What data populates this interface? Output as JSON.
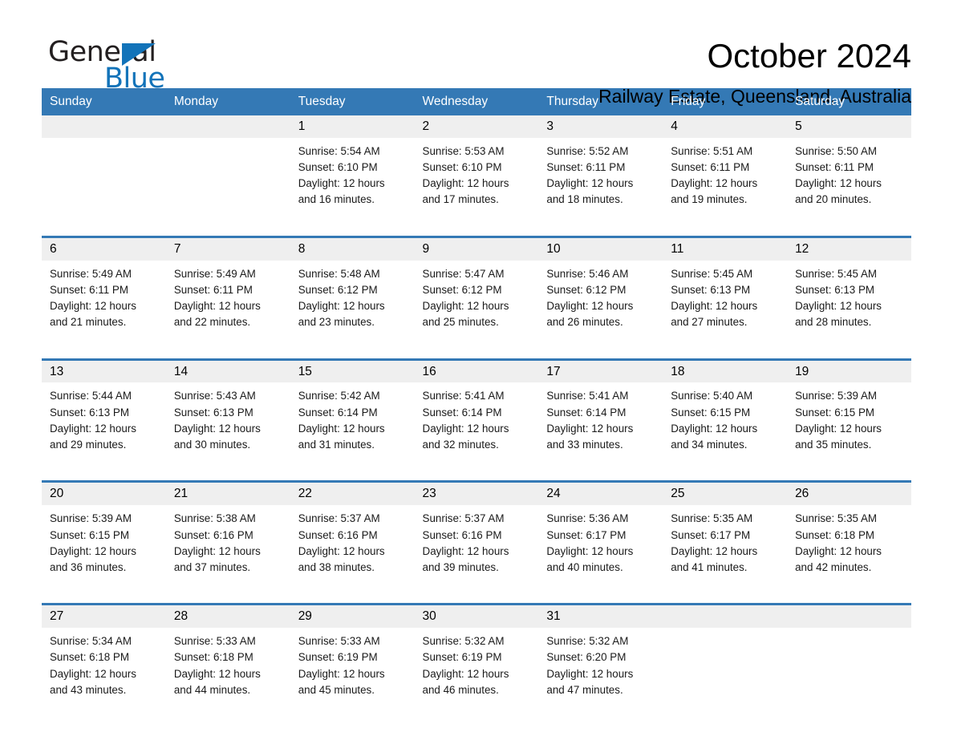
{
  "logo": {
    "word_one": "General",
    "word_two": "Blue",
    "triangle_color": "#1273b9"
  },
  "header": {
    "title": "October 2024",
    "location": "Railway Estate, Queensland, Australia"
  },
  "theme": {
    "header_blue": "#3479b5",
    "daynum_band": "#efefef",
    "text": "#000000"
  },
  "calendar": {
    "weekday_headers": [
      "Sunday",
      "Monday",
      "Tuesday",
      "Wednesday",
      "Thursday",
      "Friday",
      "Saturday"
    ],
    "weeks": [
      [
        {
          "day": "",
          "sunrise": "",
          "sunset": "",
          "daylight_line1": "",
          "daylight_line2": ""
        },
        {
          "day": "",
          "sunrise": "",
          "sunset": "",
          "daylight_line1": "",
          "daylight_line2": ""
        },
        {
          "day": "1",
          "sunrise": "Sunrise: 5:54 AM",
          "sunset": "Sunset: 6:10 PM",
          "daylight_line1": "Daylight: 12 hours",
          "daylight_line2": "and 16 minutes."
        },
        {
          "day": "2",
          "sunrise": "Sunrise: 5:53 AM",
          "sunset": "Sunset: 6:10 PM",
          "daylight_line1": "Daylight: 12 hours",
          "daylight_line2": "and 17 minutes."
        },
        {
          "day": "3",
          "sunrise": "Sunrise: 5:52 AM",
          "sunset": "Sunset: 6:11 PM",
          "daylight_line1": "Daylight: 12 hours",
          "daylight_line2": "and 18 minutes."
        },
        {
          "day": "4",
          "sunrise": "Sunrise: 5:51 AM",
          "sunset": "Sunset: 6:11 PM",
          "daylight_line1": "Daylight: 12 hours",
          "daylight_line2": "and 19 minutes."
        },
        {
          "day": "5",
          "sunrise": "Sunrise: 5:50 AM",
          "sunset": "Sunset: 6:11 PM",
          "daylight_line1": "Daylight: 12 hours",
          "daylight_line2": "and 20 minutes."
        }
      ],
      [
        {
          "day": "6",
          "sunrise": "Sunrise: 5:49 AM",
          "sunset": "Sunset: 6:11 PM",
          "daylight_line1": "Daylight: 12 hours",
          "daylight_line2": "and 21 minutes."
        },
        {
          "day": "7",
          "sunrise": "Sunrise: 5:49 AM",
          "sunset": "Sunset: 6:11 PM",
          "daylight_line1": "Daylight: 12 hours",
          "daylight_line2": "and 22 minutes."
        },
        {
          "day": "8",
          "sunrise": "Sunrise: 5:48 AM",
          "sunset": "Sunset: 6:12 PM",
          "daylight_line1": "Daylight: 12 hours",
          "daylight_line2": "and 23 minutes."
        },
        {
          "day": "9",
          "sunrise": "Sunrise: 5:47 AM",
          "sunset": "Sunset: 6:12 PM",
          "daylight_line1": "Daylight: 12 hours",
          "daylight_line2": "and 25 minutes."
        },
        {
          "day": "10",
          "sunrise": "Sunrise: 5:46 AM",
          "sunset": "Sunset: 6:12 PM",
          "daylight_line1": "Daylight: 12 hours",
          "daylight_line2": "and 26 minutes."
        },
        {
          "day": "11",
          "sunrise": "Sunrise: 5:45 AM",
          "sunset": "Sunset: 6:13 PM",
          "daylight_line1": "Daylight: 12 hours",
          "daylight_line2": "and 27 minutes."
        },
        {
          "day": "12",
          "sunrise": "Sunrise: 5:45 AM",
          "sunset": "Sunset: 6:13 PM",
          "daylight_line1": "Daylight: 12 hours",
          "daylight_line2": "and 28 minutes."
        }
      ],
      [
        {
          "day": "13",
          "sunrise": "Sunrise: 5:44 AM",
          "sunset": "Sunset: 6:13 PM",
          "daylight_line1": "Daylight: 12 hours",
          "daylight_line2": "and 29 minutes."
        },
        {
          "day": "14",
          "sunrise": "Sunrise: 5:43 AM",
          "sunset": "Sunset: 6:13 PM",
          "daylight_line1": "Daylight: 12 hours",
          "daylight_line2": "and 30 minutes."
        },
        {
          "day": "15",
          "sunrise": "Sunrise: 5:42 AM",
          "sunset": "Sunset: 6:14 PM",
          "daylight_line1": "Daylight: 12 hours",
          "daylight_line2": "and 31 minutes."
        },
        {
          "day": "16",
          "sunrise": "Sunrise: 5:41 AM",
          "sunset": "Sunset: 6:14 PM",
          "daylight_line1": "Daylight: 12 hours",
          "daylight_line2": "and 32 minutes."
        },
        {
          "day": "17",
          "sunrise": "Sunrise: 5:41 AM",
          "sunset": "Sunset: 6:14 PM",
          "daylight_line1": "Daylight: 12 hours",
          "daylight_line2": "and 33 minutes."
        },
        {
          "day": "18",
          "sunrise": "Sunrise: 5:40 AM",
          "sunset": "Sunset: 6:15 PM",
          "daylight_line1": "Daylight: 12 hours",
          "daylight_line2": "and 34 minutes."
        },
        {
          "day": "19",
          "sunrise": "Sunrise: 5:39 AM",
          "sunset": "Sunset: 6:15 PM",
          "daylight_line1": "Daylight: 12 hours",
          "daylight_line2": "and 35 minutes."
        }
      ],
      [
        {
          "day": "20",
          "sunrise": "Sunrise: 5:39 AM",
          "sunset": "Sunset: 6:15 PM",
          "daylight_line1": "Daylight: 12 hours",
          "daylight_line2": "and 36 minutes."
        },
        {
          "day": "21",
          "sunrise": "Sunrise: 5:38 AM",
          "sunset": "Sunset: 6:16 PM",
          "daylight_line1": "Daylight: 12 hours",
          "daylight_line2": "and 37 minutes."
        },
        {
          "day": "22",
          "sunrise": "Sunrise: 5:37 AM",
          "sunset": "Sunset: 6:16 PM",
          "daylight_line1": "Daylight: 12 hours",
          "daylight_line2": "and 38 minutes."
        },
        {
          "day": "23",
          "sunrise": "Sunrise: 5:37 AM",
          "sunset": "Sunset: 6:16 PM",
          "daylight_line1": "Daylight: 12 hours",
          "daylight_line2": "and 39 minutes."
        },
        {
          "day": "24",
          "sunrise": "Sunrise: 5:36 AM",
          "sunset": "Sunset: 6:17 PM",
          "daylight_line1": "Daylight: 12 hours",
          "daylight_line2": "and 40 minutes."
        },
        {
          "day": "25",
          "sunrise": "Sunrise: 5:35 AM",
          "sunset": "Sunset: 6:17 PM",
          "daylight_line1": "Daylight: 12 hours",
          "daylight_line2": "and 41 minutes."
        },
        {
          "day": "26",
          "sunrise": "Sunrise: 5:35 AM",
          "sunset": "Sunset: 6:18 PM",
          "daylight_line1": "Daylight: 12 hours",
          "daylight_line2": "and 42 minutes."
        }
      ],
      [
        {
          "day": "27",
          "sunrise": "Sunrise: 5:34 AM",
          "sunset": "Sunset: 6:18 PM",
          "daylight_line1": "Daylight: 12 hours",
          "daylight_line2": "and 43 minutes."
        },
        {
          "day": "28",
          "sunrise": "Sunrise: 5:33 AM",
          "sunset": "Sunset: 6:18 PM",
          "daylight_line1": "Daylight: 12 hours",
          "daylight_line2": "and 44 minutes."
        },
        {
          "day": "29",
          "sunrise": "Sunrise: 5:33 AM",
          "sunset": "Sunset: 6:19 PM",
          "daylight_line1": "Daylight: 12 hours",
          "daylight_line2": "and 45 minutes."
        },
        {
          "day": "30",
          "sunrise": "Sunrise: 5:32 AM",
          "sunset": "Sunset: 6:19 PM",
          "daylight_line1": "Daylight: 12 hours",
          "daylight_line2": "and 46 minutes."
        },
        {
          "day": "31",
          "sunrise": "Sunrise: 5:32 AM",
          "sunset": "Sunset: 6:20 PM",
          "daylight_line1": "Daylight: 12 hours",
          "daylight_line2": "and 47 minutes."
        },
        {
          "day": "",
          "sunrise": "",
          "sunset": "",
          "daylight_line1": "",
          "daylight_line2": ""
        },
        {
          "day": "",
          "sunrise": "",
          "sunset": "",
          "daylight_line1": "",
          "daylight_line2": ""
        }
      ]
    ]
  }
}
